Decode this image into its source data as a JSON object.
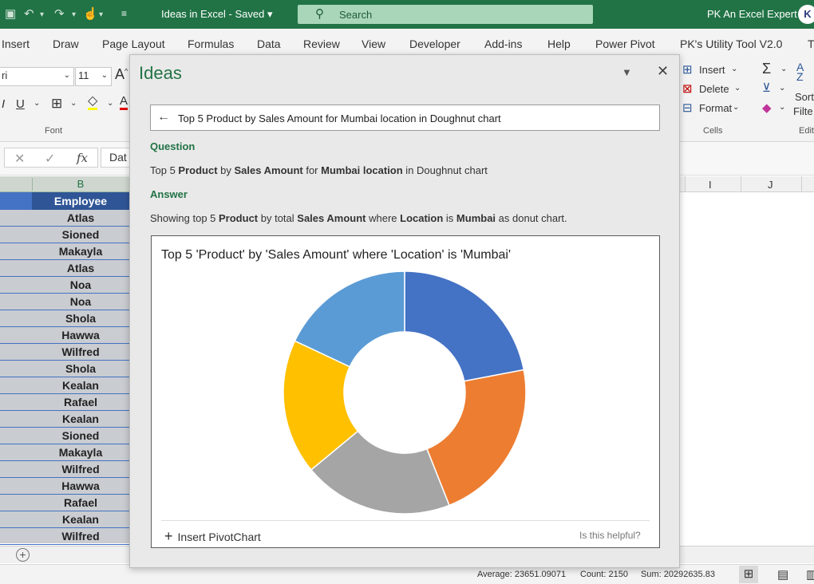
{
  "titlebar": {
    "doc_title": "Ideas in Excel  -  Saved  ▾",
    "search_label": "Search",
    "user_name": "PK An Excel Expert",
    "avatar_initial": "K"
  },
  "ribbon": {
    "tabs": [
      "Insert",
      "Draw",
      "Page Layout",
      "Formulas",
      "Data",
      "Review",
      "View",
      "Developer",
      "Add-ins",
      "Help",
      "Power Pivot",
      "PK's Utility Tool V2.0",
      "T"
    ],
    "font_name": "ri",
    "font_size": "11",
    "font_group_label": "Font",
    "cells_group_label": "Cells",
    "cells_insert": "Insert",
    "cells_delete": "Delete",
    "cells_format": "Format",
    "editing_sort": "Sort",
    "editing_filter": "Filte",
    "editing_group_label": "Edit"
  },
  "formula_bar": {
    "fx_label": "fx",
    "name_fragment": "Dat"
  },
  "columns": {
    "b_label": "B",
    "i_label": "I",
    "j_label": "J"
  },
  "sheet": {
    "header": "Employee",
    "employees": [
      "Atlas",
      "Sioned",
      "Makayla",
      "Atlas",
      "Noa",
      "Noa",
      "Shola",
      "Hawwa",
      "Wilfred",
      "Shola",
      "Kealan",
      "Rafael",
      "Kealan",
      "Sioned",
      "Makayla",
      "Wilfred",
      "Hawwa",
      "Rafael",
      "Kealan",
      "Wilfred"
    ]
  },
  "status": {
    "average": "Average: 23651.09071",
    "count": "Count: 2150",
    "sum": "Sum: 20292635.83"
  },
  "ideas": {
    "title": "Ideas",
    "query": "Top 5 Product by Sales Amount for Mumbai location in Doughnut chart",
    "question_heading": "Question",
    "question_parts": [
      "Top 5 ",
      "Product",
      " by ",
      "Sales Amount",
      " for ",
      "Mumbai location",
      " in Doughnut chart"
    ],
    "answer_heading": "Answer",
    "answer_parts": [
      "Showing top 5 ",
      "Product",
      " by total ",
      "Sales Amount",
      " where ",
      "Location",
      " is ",
      "Mumbai",
      " as donut chart."
    ],
    "insert_label": "Insert PivotChart",
    "helpful_label": "Is this helpful?"
  },
  "chart_data": {
    "type": "pie",
    "title": "Top 5 'Product' by 'Sales Amount' where 'Location' is 'Mumbai'",
    "donut": true,
    "values": [
      22,
      22,
      20,
      18,
      18
    ],
    "colors": [
      "#4472c4",
      "#ed7d31",
      "#a5a5a5",
      "#ffc000",
      "#5b9bd5"
    ]
  },
  "colors": {
    "excel_green": "#217346",
    "header_blue": "#2f5597"
  }
}
